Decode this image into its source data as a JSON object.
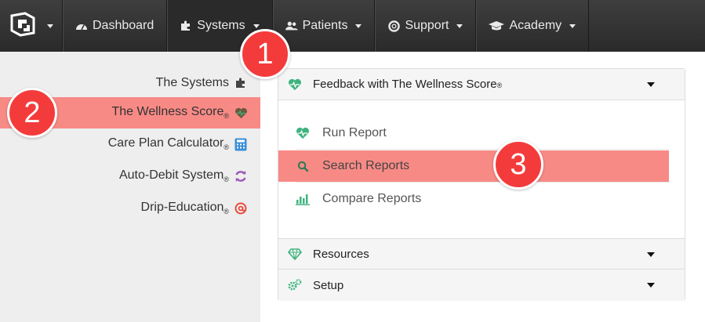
{
  "colors": {
    "nav_bg": "#333333",
    "highlight": "#f88a86",
    "callout": "#f43b3b",
    "green_icon": "#3fb37f",
    "sidebar_bg": "#eeeeee"
  },
  "topnav": {
    "logo_icon": "brand-logo-icon",
    "items": [
      {
        "label": "Dashboard",
        "icon": "dashboard-gauge-icon",
        "has_caret": false
      },
      {
        "label": "Systems",
        "icon": "puzzle-icon",
        "has_caret": true
      },
      {
        "label": "Patients",
        "icon": "users-icon",
        "has_caret": true
      },
      {
        "label": "Support",
        "icon": "lifebuoy-icon",
        "has_caret": true
      },
      {
        "label": "Academy",
        "icon": "graduation-cap-icon",
        "has_caret": true
      }
    ]
  },
  "sidebar": {
    "items": [
      {
        "label": "The Systems",
        "reg": "",
        "icon": "puzzle-icon",
        "active": false
      },
      {
        "label": "The Wellness Score",
        "reg": "®",
        "icon": "heart-icon",
        "active": true
      },
      {
        "label": "Care Plan Calculator",
        "reg": "®",
        "icon": "calculator-icon",
        "active": false
      },
      {
        "label": "Auto-Debit System",
        "reg": "®",
        "icon": "refresh-icon",
        "active": false
      },
      {
        "label": "Drip-Education",
        "reg": "®",
        "icon": "at-sign-icon",
        "active": false
      }
    ]
  },
  "panel": {
    "sections": [
      {
        "title": "Feedback with The Wellness Score",
        "reg": "®",
        "icon": "heartbeat-icon"
      },
      {
        "title": "Resources",
        "reg": "",
        "icon": "diamond-icon"
      },
      {
        "title": "Setup",
        "reg": "",
        "icon": "cogs-icon"
      }
    ],
    "sub_items": [
      {
        "label": "Run Report",
        "icon": "heartbeat-icon",
        "active": false
      },
      {
        "label": "Search Reports",
        "icon": "search-icon",
        "active": true
      },
      {
        "label": "Compare Reports",
        "icon": "bar-chart-icon",
        "active": false
      }
    ]
  },
  "callouts": [
    "1",
    "2",
    "3"
  ]
}
